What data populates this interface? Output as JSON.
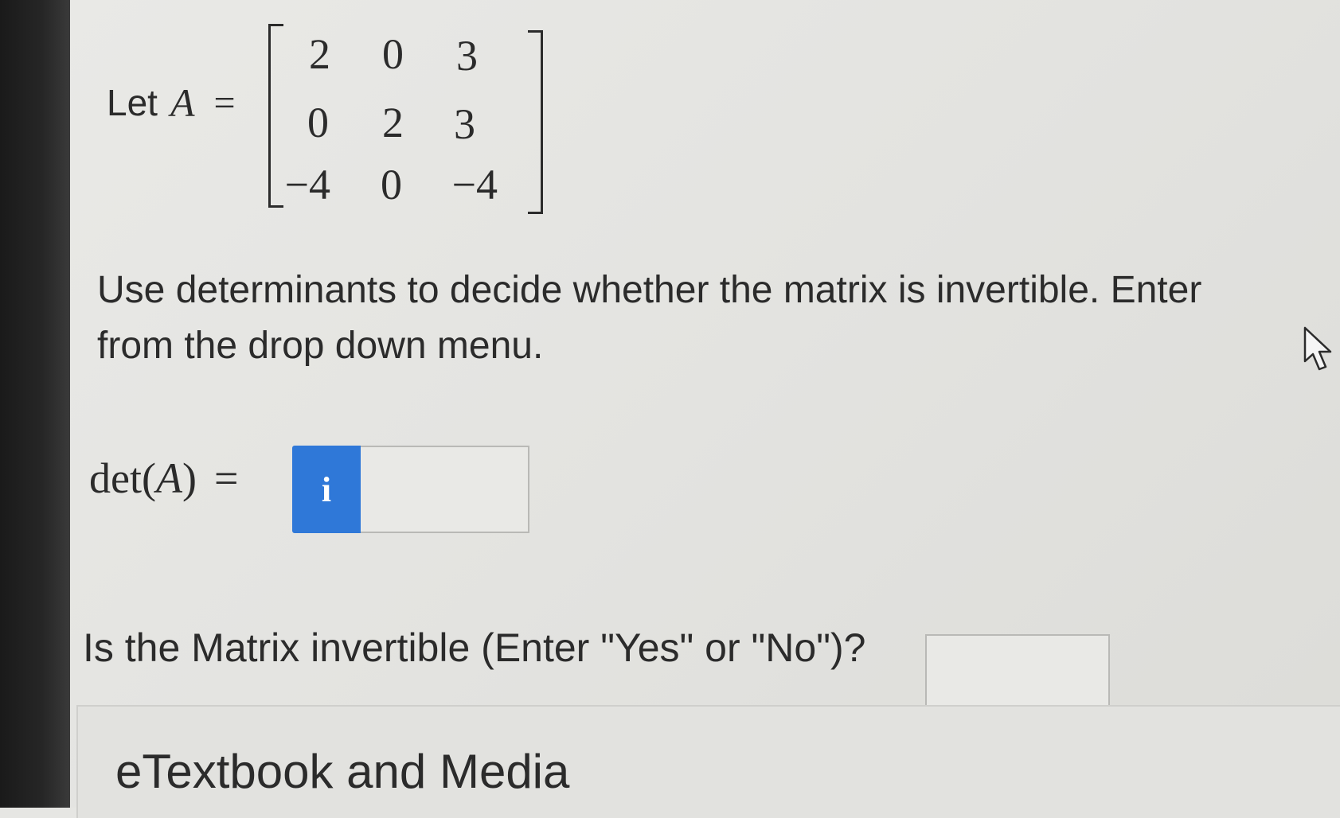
{
  "problem": {
    "let_text": "Let",
    "variable": "A",
    "equals": "=",
    "matrix": [
      [
        "2",
        "0",
        "3"
      ],
      [
        "0",
        "2",
        "3"
      ],
      [
        "−4",
        "0",
        "−4"
      ]
    ],
    "instruction_line1": "Use determinants to decide whether the matrix is invertible. Enter",
    "instruction_line2": "from the drop down menu."
  },
  "determinant": {
    "label_prefix": "det(",
    "label_var": "A",
    "label_suffix": ")",
    "equals": "=",
    "info_icon_glyph": "i",
    "value": ""
  },
  "question": {
    "text": "Is the Matrix invertible (Enter \"Yes\" or \"No\")?",
    "value": ""
  },
  "media": {
    "label": "eTextbook and Media"
  },
  "colors": {
    "info_button": "#2f78d8",
    "background": "#e6e6e3",
    "text": "#2b2b2b"
  }
}
